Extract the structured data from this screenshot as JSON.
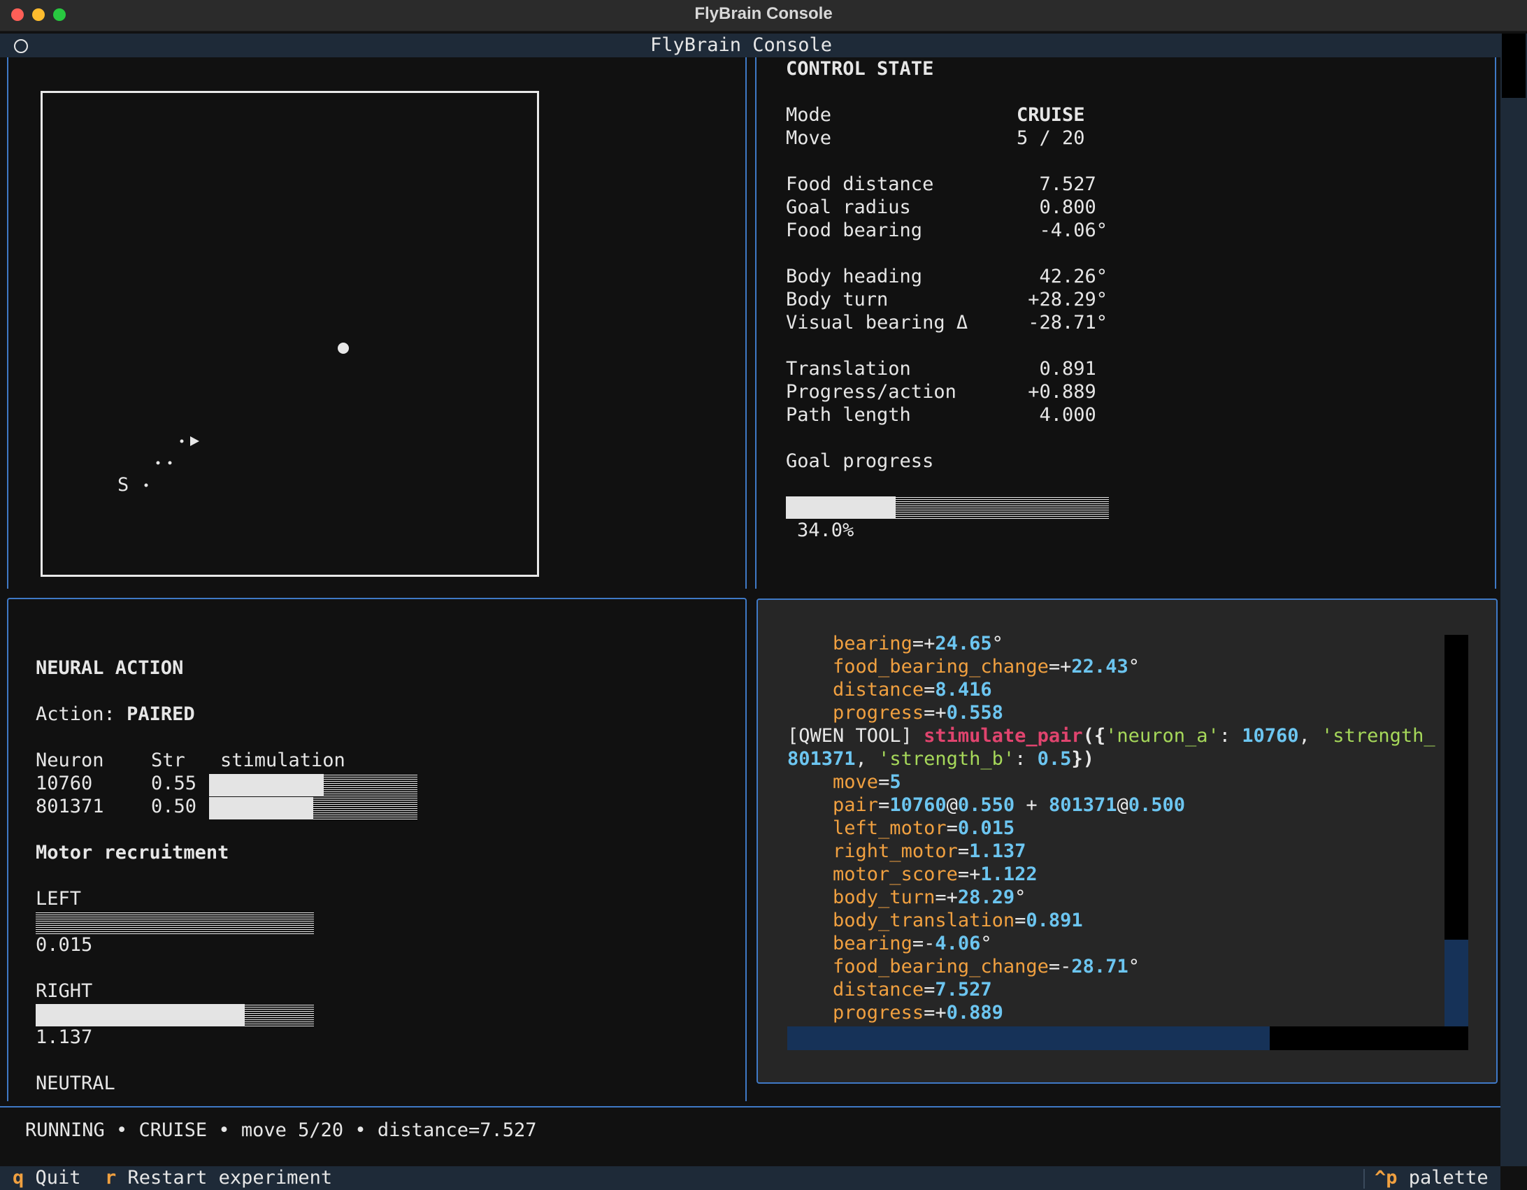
{
  "window": {
    "title": "FlyBrain Console"
  },
  "app": {
    "title": "FlyBrain Console"
  },
  "arena": {
    "start_label": "S"
  },
  "control": {
    "heading": "CONTROL STATE",
    "rows": [
      {
        "label": "Mode",
        "value": "CRUISE",
        "bold": true
      },
      {
        "label": "Move",
        "value": "5 / 20"
      },
      {
        "label": "",
        "value": ""
      },
      {
        "label": "Food distance",
        "value": "  7.527"
      },
      {
        "label": "Goal radius",
        "value": "  0.800"
      },
      {
        "label": "Food bearing",
        "value": "  -4.06°"
      },
      {
        "label": "",
        "value": ""
      },
      {
        "label": "Body heading",
        "value": "  42.26°"
      },
      {
        "label": "Body turn",
        "value": " +28.29°"
      },
      {
        "label": "Visual bearing Δ",
        "value": " -28.71°"
      },
      {
        "label": "",
        "value": ""
      },
      {
        "label": "Translation",
        "value": "  0.891"
      },
      {
        "label": "Progress/action",
        "value": " +0.889"
      },
      {
        "label": "Path length",
        "value": "  4.000"
      }
    ],
    "goal_label": "Goal progress",
    "goal_progress": 0.34,
    "goal_text": "34.0%"
  },
  "neural": {
    "heading": "NEURAL ACTION",
    "action_label": "Action:",
    "action_value": "PAIRED",
    "col_neuron": "Neuron",
    "col_str": "Str",
    "col_stim": "stimulation",
    "neurons": [
      {
        "id": "10760",
        "str": "0.55",
        "level": 0.55
      },
      {
        "id": "801371",
        "str": "0.50",
        "level": 0.5
      }
    ],
    "motor_heading": "Motor recruitment",
    "motors": [
      {
        "label": "LEFT",
        "value": "0.015",
        "level": 0.0
      },
      {
        "label": "RIGHT",
        "value": "1.137",
        "level": 0.75
      },
      {
        "label": "NEUTRAL",
        "value": "",
        "level": null
      }
    ]
  },
  "log": {
    "lines": [
      {
        "indent": true,
        "key": "bearing",
        "sign": "+",
        "val": "24.65",
        "unit": "°"
      },
      {
        "indent": true,
        "key": "food_bearing_change",
        "sign": "+",
        "val": "22.43",
        "unit": "°"
      },
      {
        "indent": true,
        "key": "distance",
        "sign": "",
        "val": "8.416",
        "unit": ""
      },
      {
        "indent": true,
        "key": "progress",
        "sign": "+",
        "val": "0.558",
        "unit": ""
      }
    ],
    "tool_prefix": "[QWEN TOOL]",
    "tool_fn": "stimulate_pair",
    "tool_line1_a": "({",
    "tool_s1": "'neuron_a'",
    "tool_c1": ": ",
    "tool_n1": "10760",
    "tool_c2": ", ",
    "tool_s2": "'strength_",
    "tool_n2": "801371",
    "tool_c3": ", ",
    "tool_s3": "'strength_b'",
    "tool_c4": ": ",
    "tool_n3": "0.5",
    "tool_end": "})",
    "after": [
      {
        "key": "move",
        "sign": "",
        "val": "5",
        "unit": ""
      },
      {
        "key": "pair",
        "sign": "",
        "val": "10760",
        "unit": "",
        "pair": true
      },
      {
        "key": "left_motor",
        "sign": "",
        "val": "0.015",
        "unit": ""
      },
      {
        "key": "right_motor",
        "sign": "",
        "val": "1.137",
        "unit": ""
      },
      {
        "key": "motor_score",
        "sign": "+",
        "val": "1.122",
        "unit": ""
      },
      {
        "key": "body_turn",
        "sign": "+",
        "val": "28.29",
        "unit": "°"
      },
      {
        "key": "body_translation",
        "sign": "",
        "val": "0.891",
        "unit": ""
      },
      {
        "key": "bearing",
        "sign": "-",
        "val": "4.06",
        "unit": "°"
      },
      {
        "key": "food_bearing_change",
        "sign": "-",
        "val": "28.71",
        "unit": "°"
      },
      {
        "key": "distance",
        "sign": "",
        "val": "7.527",
        "unit": ""
      },
      {
        "key": "progress",
        "sign": "+",
        "val": "0.889",
        "unit": ""
      }
    ],
    "pair_a": "10760",
    "pair_at1": "@",
    "pair_s1": "0.550",
    "pair_plus": " + ",
    "pair_b": "801371",
    "pair_at2": "@",
    "pair_s2": "0.500"
  },
  "status": {
    "text": "RUNNING • CRUISE • move 5/20 • distance=7.527"
  },
  "footer": {
    "quit_key": "q",
    "quit_label": "Quit",
    "restart_key": "r",
    "restart_label": "Restart experiment",
    "palette_key": "^p",
    "palette_label": "palette"
  },
  "colors": {
    "panel_border": "#3f79c6",
    "key": "#f0a040",
    "number": "#6cc5f0",
    "function": "#e0446e",
    "string": "#a6d85a"
  }
}
